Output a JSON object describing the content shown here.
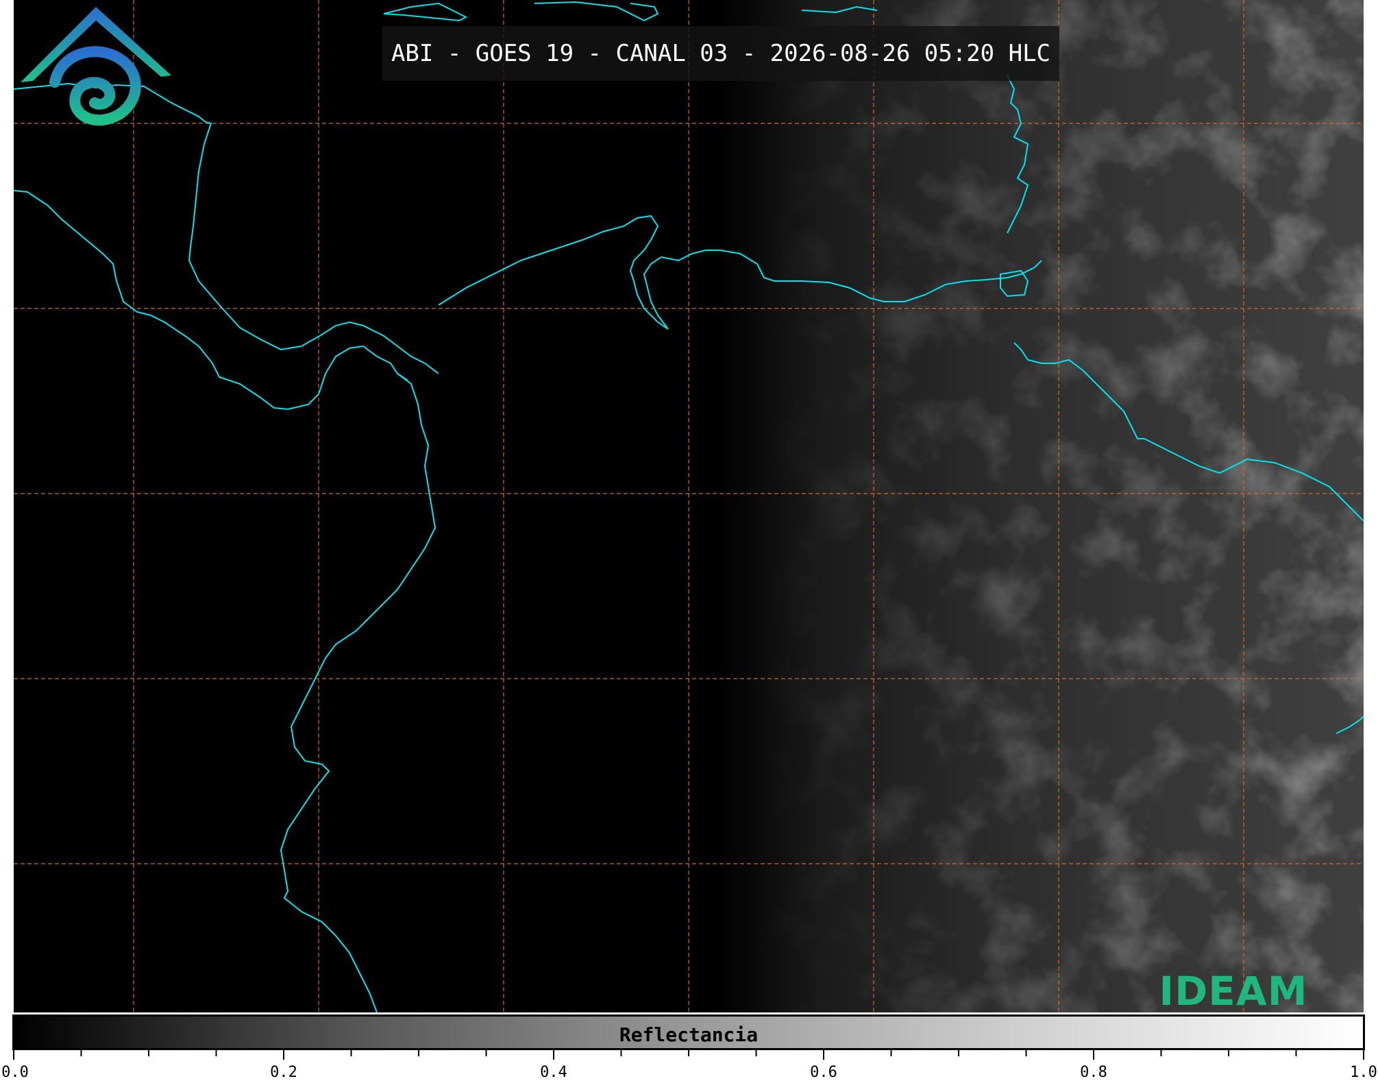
{
  "map": {
    "title": "ABI - GOES 19 - CANAL 03 - 2026-08-26 05:20 HLC",
    "coastline_color": "#00e5ee",
    "grid_color": "#d26a2a"
  },
  "logo": {
    "text": "IDEAM",
    "icon": "ideam-logo-icon"
  },
  "colorbar": {
    "label": "Reflectancia",
    "ticks": [
      "0.0",
      "0.2",
      "0.4",
      "0.6",
      "0.8",
      "1.0"
    ],
    "range": [
      0.0,
      1.0
    ],
    "colors": [
      "#000000",
      "#ffffff"
    ]
  }
}
